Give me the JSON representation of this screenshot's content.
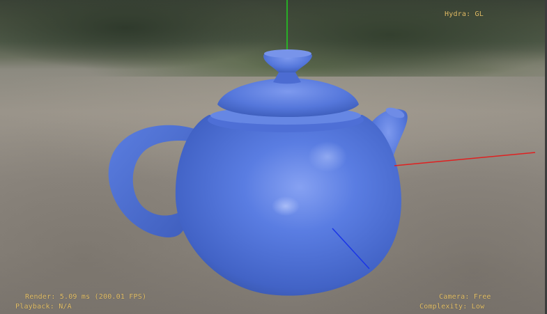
{
  "hud": {
    "renderer": "Hydra: GL",
    "render_time": "Render: 5.09 ms (200.01 FPS)",
    "playback": "Playback: N/A",
    "camera": "Camera: Free",
    "complexity": "Complexity: Low"
  },
  "scene": {
    "object": "teapot",
    "object_color": "#4f72d8",
    "axis_colors": {
      "x": "#e02020",
      "y": "#20d020",
      "z": "#1a35e6"
    },
    "hud_color": "#e6c26a"
  }
}
